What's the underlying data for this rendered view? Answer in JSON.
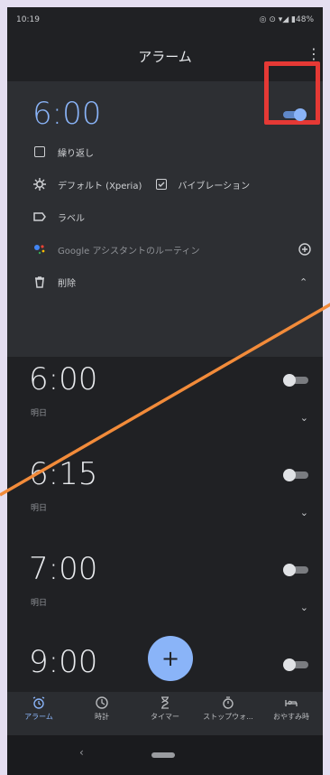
{
  "status_bar": {
    "time": "10:19",
    "icons_text": "◎ ⊙ ▾◢ ▮48%"
  },
  "app_bar": {
    "title": "アラーム"
  },
  "expanded_alarm": {
    "time": "6:00",
    "enabled": true,
    "repeat_label": "繰り返し",
    "sound_label": "デフォルト (Xperia)",
    "vibrate_label": "バイブレーション",
    "vibrate_checked": true,
    "label_placeholder": "ラベル",
    "assistant_label": "Google アシスタントのルーティン",
    "delete_label": "削除"
  },
  "alarms": [
    {
      "time": "6:00",
      "day": "明日",
      "enabled": false
    },
    {
      "time": "6:15",
      "day": "明日",
      "enabled": false
    },
    {
      "time": "7:00",
      "day": "明日",
      "enabled": false
    },
    {
      "time": "9:00",
      "day": "",
      "enabled": false
    }
  ],
  "bottom_nav": [
    {
      "label": "アラーム",
      "icon": "alarm-icon",
      "active": true
    },
    {
      "label": "時計",
      "icon": "clock-icon",
      "active": false
    },
    {
      "label": "タイマー",
      "icon": "hourglass-icon",
      "active": false
    },
    {
      "label": "ストップウォ...",
      "icon": "stopwatch-icon",
      "active": false
    },
    {
      "label": "おやすみ時",
      "icon": "bed-icon",
      "active": false
    }
  ],
  "colors": {
    "accent": "#8ab4f8",
    "highlight": "#e53935",
    "pointer": "#f28b3a"
  }
}
